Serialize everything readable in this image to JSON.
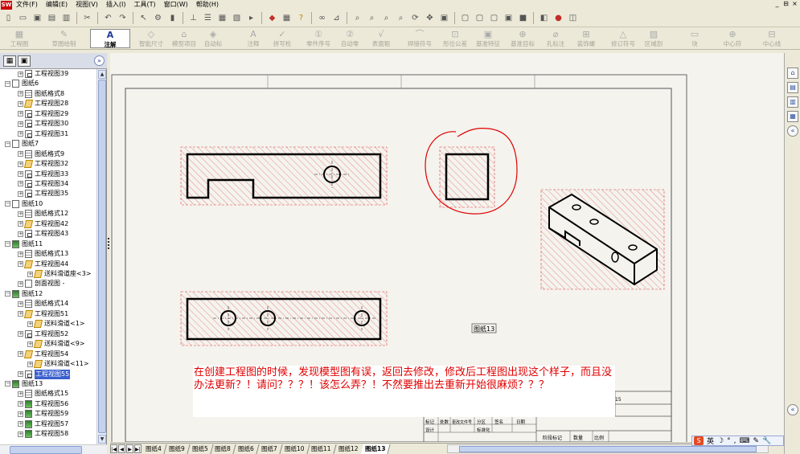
{
  "menu": {
    "logo": "SW",
    "items": [
      "文件(F)",
      "编辑(E)",
      "视图(V)",
      "插入(I)",
      "工具(T)",
      "窗口(W)",
      "帮助(H)"
    ],
    "window_controls": [
      "_",
      "⊟",
      "×"
    ]
  },
  "toolbar_annotate": {
    "items": [
      {
        "label": "工程图",
        "icon": "drawing-icon"
      },
      {
        "label": "草图绘制",
        "icon": "sketch-icon"
      },
      {
        "label": "注解",
        "icon": "annotation-icon",
        "active": true
      },
      {
        "label": "智能尺寸",
        "icon": "smart-dimension-icon"
      },
      {
        "label": "模型项目",
        "icon": "model-items-icon"
      },
      {
        "label": "自动标",
        "icon": "auto-balloon-icon"
      },
      {
        "label": "注释",
        "icon": "note-icon"
      },
      {
        "label": "拼写检",
        "icon": "spell-check-icon"
      },
      {
        "label": "零件序号",
        "icon": "balloon-icon"
      },
      {
        "label": "自动零",
        "icon": "auto-balloon-2-icon"
      },
      {
        "label": "表面粗",
        "icon": "surface-finish-icon"
      },
      {
        "label": "焊接符号",
        "icon": "weld-symbol-icon"
      },
      {
        "label": "形位公差",
        "icon": "geometric-tolerance-icon"
      },
      {
        "label": "基准特征",
        "icon": "datum-feature-icon"
      },
      {
        "label": "基准目标",
        "icon": "datum-target-icon"
      },
      {
        "label": "孔标注",
        "icon": "hole-callout-icon"
      },
      {
        "label": "装饰螺",
        "icon": "cosmetic-thread-icon"
      },
      {
        "label": "修订符号",
        "icon": "revision-symbol-icon"
      },
      {
        "label": "区域剖",
        "icon": "area-hatch-icon"
      },
      {
        "label": "块",
        "icon": "block-icon"
      },
      {
        "label": "中心符",
        "icon": "center-mark-icon"
      },
      {
        "label": "中心线",
        "icon": "centerline-icon"
      }
    ]
  },
  "tree": {
    "items": [
      {
        "label": "工程视图39",
        "icon": "view",
        "level": 2
      },
      {
        "label": "图纸6",
        "icon": "sheet",
        "level": 1
      },
      {
        "label": "图纸格式8",
        "icon": "fmt",
        "level": 2
      },
      {
        "label": "工程视图28",
        "icon": "part",
        "level": 2
      },
      {
        "label": "工程视图29",
        "icon": "view",
        "level": 2
      },
      {
        "label": "工程视图30",
        "icon": "view",
        "level": 2
      },
      {
        "label": "工程视图31",
        "icon": "view",
        "level": 2
      },
      {
        "label": "图纸7",
        "icon": "sheet",
        "level": 1
      },
      {
        "label": "图纸格式9",
        "icon": "fmt",
        "level": 2
      },
      {
        "label": "工程视图32",
        "icon": "part",
        "level": 2
      },
      {
        "label": "工程视图33",
        "icon": "view",
        "level": 2
      },
      {
        "label": "工程视图34",
        "icon": "view",
        "level": 2
      },
      {
        "label": "工程视图35",
        "icon": "view",
        "level": 2
      },
      {
        "label": "图纸10",
        "icon": "sheet",
        "level": 1
      },
      {
        "label": "图纸格式12",
        "icon": "fmt",
        "level": 2
      },
      {
        "label": "工程视图42",
        "icon": "part",
        "level": 2
      },
      {
        "label": "工程视图43",
        "icon": "view",
        "level": 2
      },
      {
        "label": "图纸11",
        "icon": "sheet13",
        "level": 1
      },
      {
        "label": "图纸格式13",
        "icon": "fmt",
        "level": 2
      },
      {
        "label": "工程视图44",
        "icon": "part",
        "level": 2
      },
      {
        "label": "送料滑道座<3>",
        "icon": "part",
        "level": 3
      },
      {
        "label": "剖面视图 -",
        "icon": "sect",
        "level": 2
      },
      {
        "label": "图纸12",
        "icon": "sheet13",
        "level": 1
      },
      {
        "label": "图纸格式14",
        "icon": "fmt",
        "level": 2
      },
      {
        "label": "工程视图51",
        "icon": "part",
        "level": 2
      },
      {
        "label": "送料滑道<1>",
        "icon": "part",
        "level": 3
      },
      {
        "label": "工程视图52",
        "icon": "view",
        "level": 2
      },
      {
        "label": "送料滑道<9>",
        "icon": "part",
        "level": 3
      },
      {
        "label": "工程视图54",
        "icon": "part",
        "level": 2
      },
      {
        "label": "送料滑道<11>",
        "icon": "part",
        "level": 3
      },
      {
        "label": "工程视图55",
        "icon": "view",
        "level": 2,
        "selected": true
      },
      {
        "label": "图纸13",
        "icon": "sheet13",
        "level": 1
      },
      {
        "label": "图纸格式15",
        "icon": "fmt",
        "level": 2
      },
      {
        "label": "工程视图56",
        "icon": "sheet13",
        "level": 2
      },
      {
        "label": "工程视图59",
        "icon": "sheet13",
        "level": 2
      },
      {
        "label": "工程视图57",
        "icon": "sheet13",
        "level": 2
      },
      {
        "label": "工程视图58",
        "icon": "sheet13",
        "level": 2
      }
    ]
  },
  "drawing": {
    "sheet_label": "图纸13",
    "title_block": {
      "row1": [
        "标记",
        "处数",
        "更改文件号",
        "分区",
        "签名",
        "日期"
      ],
      "row2": [
        "设计",
        "",
        "标准化",
        ""
      ],
      "row3": [
        "阶段标记",
        "数量",
        "比例"
      ],
      "right_num": "15"
    }
  },
  "question": {
    "text": "在创建工程图的时候，发现模型图有误，返回去修改，修改后工程图出现这个样子，而且没办法更新？！请问？？？！该怎么弄？！不然要推出去重新开始很麻烦？？？"
  },
  "sheet_tabs": {
    "nav": [
      "|◀",
      "◀",
      "▶",
      "▶|"
    ],
    "tabs": [
      "图纸4",
      "图纸9",
      "图纸5",
      "图纸8",
      "图纸6",
      "图纸7",
      "图纸10",
      "图纸11",
      "图纸12",
      "图纸13"
    ],
    "active": "图纸13"
  },
  "ime": {
    "lang": "英",
    "icons": [
      "☽",
      "°",
      ",",
      "⌨",
      "✎",
      "🔧"
    ]
  },
  "colors": {
    "hatch": "#e04040",
    "geometry": "#000000",
    "circle_mark": "#e00000",
    "question_text": "#e00000"
  }
}
